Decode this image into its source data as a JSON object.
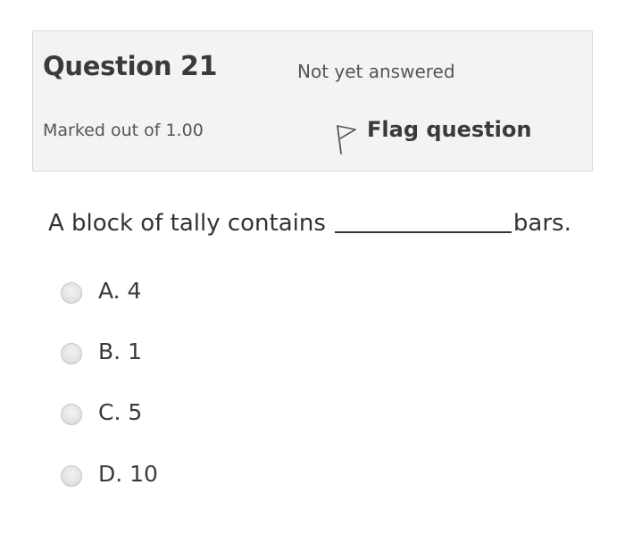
{
  "question": {
    "title_prefix": "Question",
    "number": "21",
    "state": "Not yet answered",
    "grade": "Marked out of 1.00",
    "flag_label": "Flag question",
    "flag_icon": "flag-outline-icon"
  },
  "prompt": {
    "before_blank": "A block of tally contains",
    "after_blank": "bars."
  },
  "options": [
    {
      "label": "A. 4",
      "selected": false
    },
    {
      "label": "B. 1",
      "selected": false
    },
    {
      "label": "C. 5",
      "selected": false
    },
    {
      "label": "D. 10",
      "selected": false
    }
  ],
  "colors": {
    "info_background": "#f3f3f3",
    "info_border": "#d7d7d7",
    "text": "#3a3a3a",
    "muted_text": "#555555"
  }
}
